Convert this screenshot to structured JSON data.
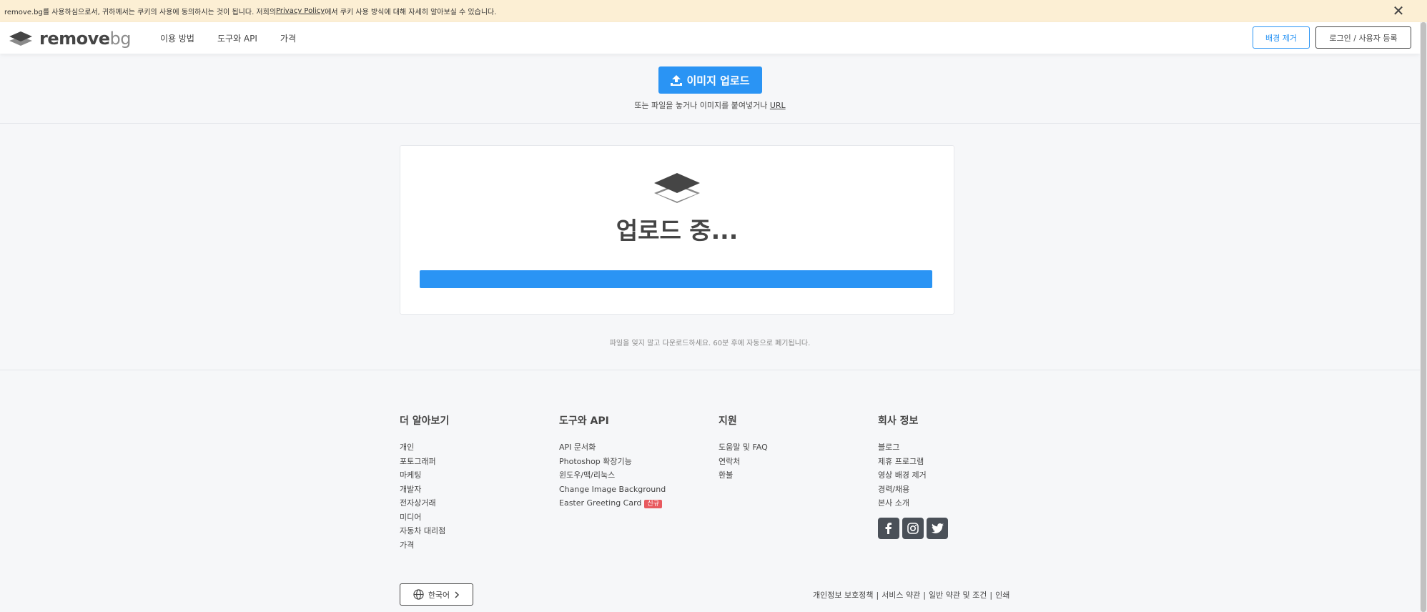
{
  "cookie": {
    "text_before": "remove.bg를 사용하심으로서, 귀하께서는 쿠키의 사용에 동의하시는 것이 됩니다. 저희의 ",
    "link": "Privacy Policy",
    "text_after": "에서 쿠키 사용 방식에 대해 자세히 알아보실 수 있습니다.",
    "close": "✕"
  },
  "nav": {
    "logo_main": "remove",
    "logo_bg": "bg",
    "links": [
      "이용 방법",
      "도구와 API",
      "가격"
    ],
    "remove_bg_button": "배경 제거",
    "login_button": "로그인 / 사용자 등록"
  },
  "upload": {
    "button_label": "이미지 업로드",
    "sub_text": "또는 파일을 놓거나 이미지를 붙여넣거나 ",
    "sub_link": "URL"
  },
  "card": {
    "title": "업로드 중...",
    "progress": 1.0
  },
  "note": "파일을 잊지 말고 다운로드하세요. 60분 후에 자동으로 폐기됩니다.",
  "footer": {
    "columns": [
      {
        "title": "더 알아보기",
        "items": [
          "개인",
          "포토그래퍼",
          "마케팅",
          "개발자",
          "전자상거래",
          "미디어",
          "자동차 대리점",
          "가격"
        ]
      },
      {
        "title": "도구와 API",
        "items": [
          "API 문서화",
          "Photoshop 확장기능",
          "윈도우/맥/리눅스",
          "Change Image Background",
          "Easter Greeting Card"
        ],
        "badge": "신규"
      },
      {
        "title": "지원",
        "items": [
          "도움말 및 FAQ",
          "연락처",
          "환불"
        ]
      },
      {
        "title": "회사 정보",
        "items": [
          "블로그",
          "제휴 프로그램",
          "영상 배경 제거",
          "경력/채용",
          "본사 소개"
        ]
      }
    ],
    "language": "한국어",
    "legal": [
      "개인정보 보호정책",
      "서비스 약관",
      "일반 약관 및 조건",
      "인쇄"
    ]
  },
  "colors": {
    "accent": "#2a94f4",
    "banner": "#fcefd4",
    "text": "#454545",
    "badge": "#e8595f"
  }
}
